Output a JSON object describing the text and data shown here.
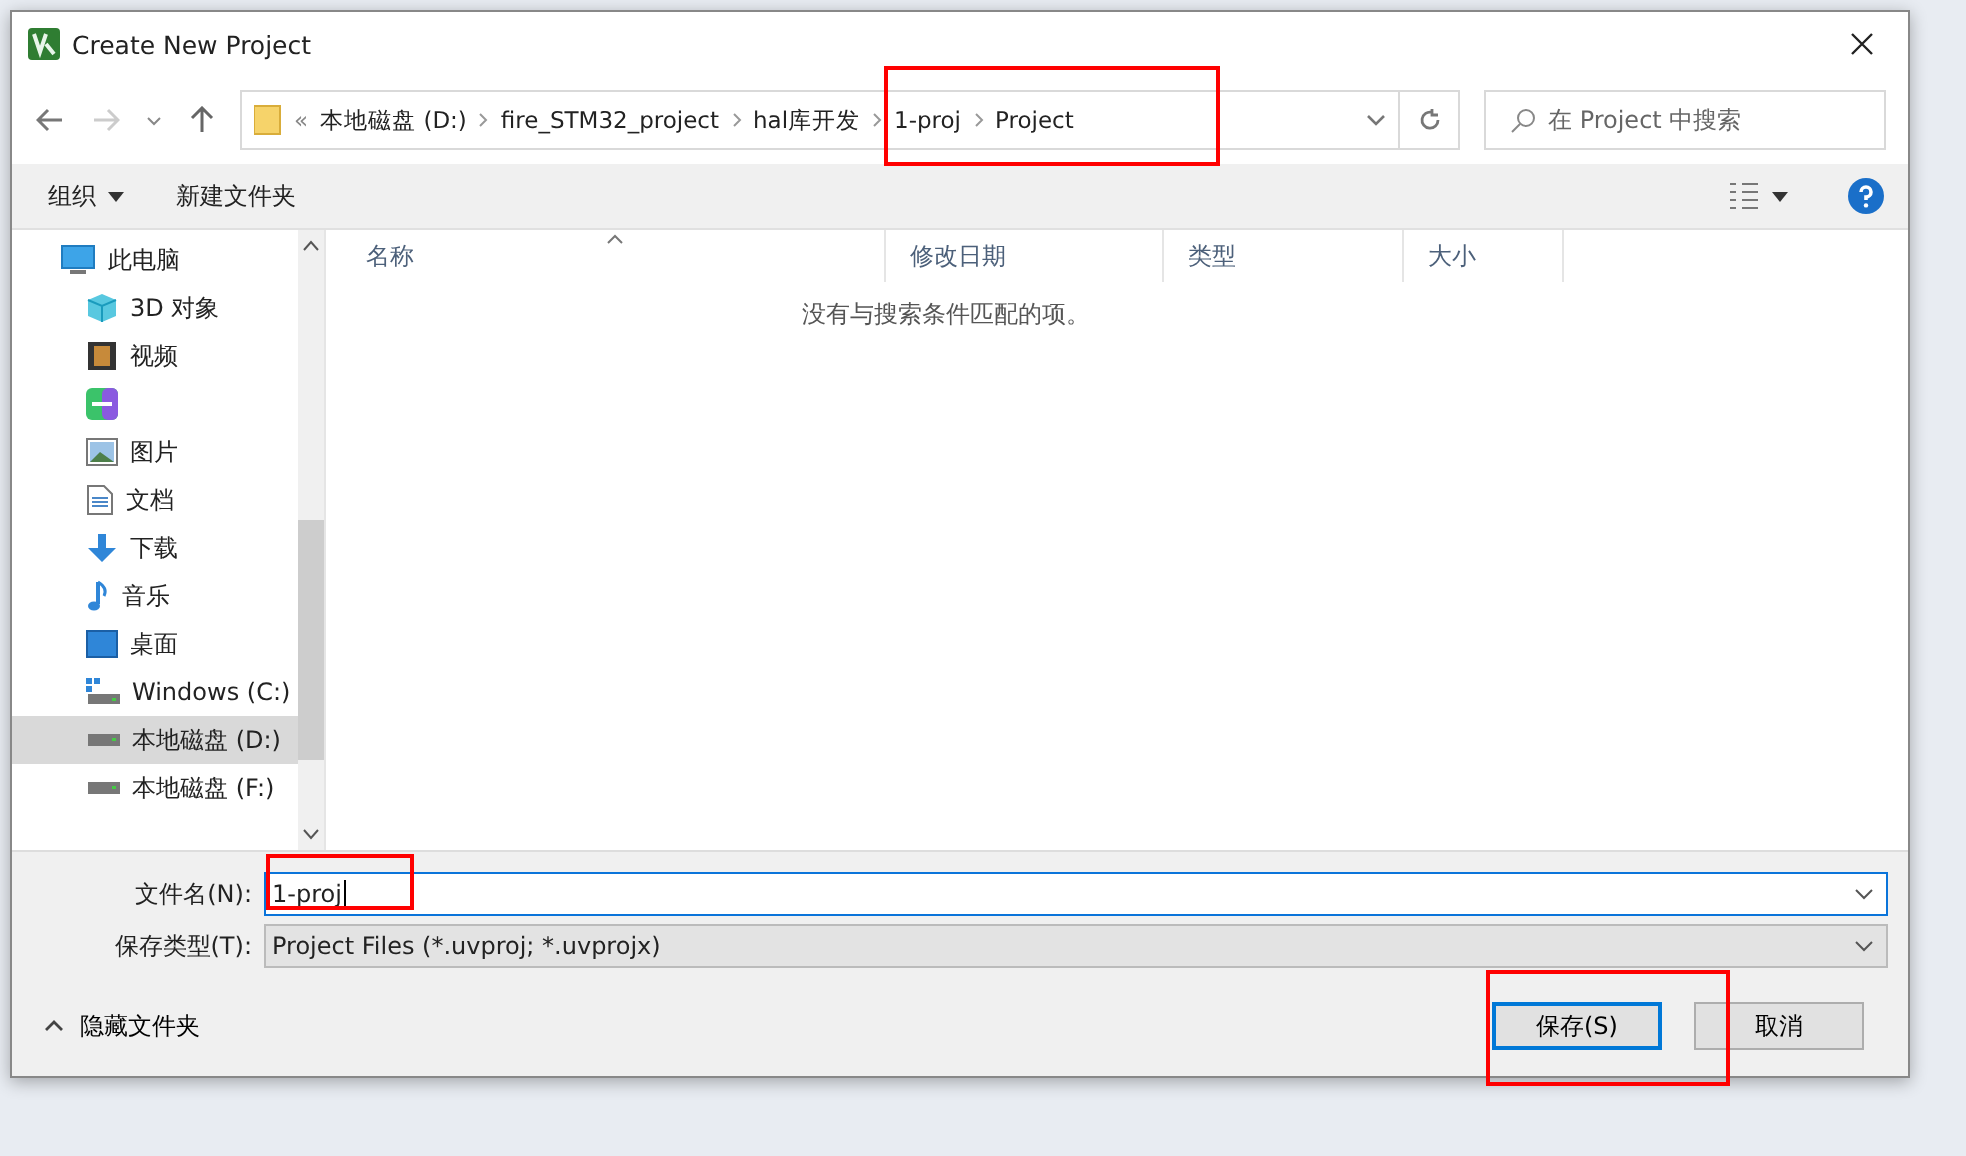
{
  "window": {
    "title": "Create New Project"
  },
  "nav": {
    "forward_disabled": true,
    "breadcrumbs": [
      "«",
      "本地磁盘 (D:)",
      "fire_STM32_project",
      "hal库开发",
      "1-proj",
      "Project"
    ],
    "search": {
      "placeholder": "在 Project 中搜索"
    }
  },
  "toolbar": {
    "organize": "组织",
    "new_folder": "新建文件夹"
  },
  "sidebar": {
    "items": [
      {
        "label": "此电脑",
        "kind": "pc",
        "selected": false
      },
      {
        "label": "3D 对象",
        "kind": "cube",
        "selected": false
      },
      {
        "label": "视频",
        "kind": "video",
        "selected": false
      },
      {
        "kind": "app",
        "selected": false
      },
      {
        "label": "图片",
        "kind": "pictures",
        "selected": false
      },
      {
        "label": "文档",
        "kind": "docs",
        "selected": false
      },
      {
        "label": "下载",
        "kind": "download",
        "selected": false
      },
      {
        "label": "音乐",
        "kind": "music",
        "selected": false
      },
      {
        "label": "桌面",
        "kind": "desktop",
        "selected": false
      },
      {
        "label": "Windows (C:)",
        "kind": "windrive",
        "selected": false
      },
      {
        "label": "本地磁盘 (D:)",
        "kind": "drive",
        "selected": true
      },
      {
        "label": "本地磁盘 (F:)",
        "kind": "drive",
        "selected": false
      }
    ]
  },
  "table": {
    "columns": [
      "名称",
      "修改日期",
      "类型",
      "大小"
    ],
    "empty_message": "没有与搜索条件匹配的项。"
  },
  "form": {
    "filename_label": "文件名(N):",
    "filename": "1-proj",
    "filetype_label": "保存类型(T):",
    "filetype": "Project Files (*.uvproj; *.uvprojx)"
  },
  "hide_folders": "隐藏文件夹",
  "buttons": [
    {
      "label": "保存(S)",
      "default": true
    },
    {
      "label": "取消",
      "default": false
    }
  ]
}
